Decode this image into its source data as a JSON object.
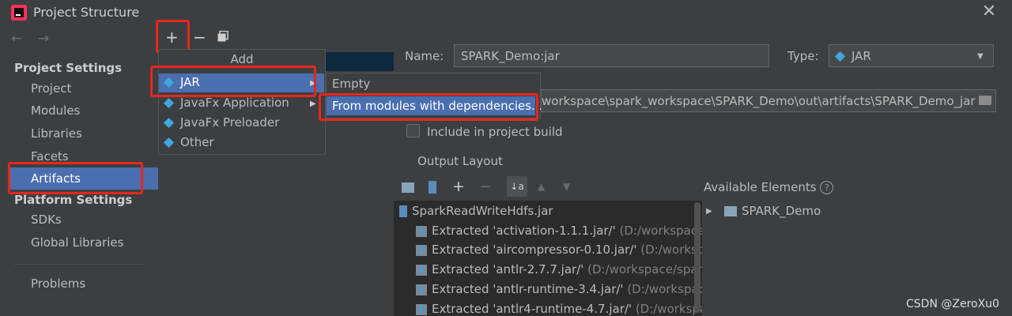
{
  "window": {
    "title": "Project Structure",
    "close_icon": "close-icon",
    "app_icon": "intellij-idea-icon"
  },
  "sidebar": {
    "back_icon": "arrow-left-icon",
    "forward_icon": "arrow-right-icon",
    "project_settings_header": "Project Settings",
    "items": [
      "Project",
      "Modules",
      "Libraries",
      "Facets",
      "Artifacts"
    ],
    "selected": "Artifacts",
    "platform_settings_header": "Platform Settings",
    "platform_items": [
      "SDKs",
      "Global Libraries"
    ],
    "problems": "Problems"
  },
  "list_toolbar": {
    "add_icon": "plus-icon",
    "remove_icon": "minus-icon",
    "copy_icon": "copy-icon"
  },
  "add_menu": {
    "title": "Add",
    "items": [
      "JAR",
      "JavaFx Application",
      "JavaFx Preloader",
      "Other"
    ],
    "selected": "JAR",
    "icon": "artifact-diamond-icon"
  },
  "jar_submenu": {
    "items": [
      "Empty",
      "From modules with dependencies..."
    ],
    "selected": "From modules with dependencies..."
  },
  "form": {
    "name_label": "Name:",
    "name_value": "SPARK_Demo:jar",
    "type_label": "Type:",
    "type_value": "JAR",
    "output_dir_value": "workspace\\spark_workspace\\SPARK_Demo\\out\\artifacts\\SPARK_Demo_jar",
    "include_in_build_label": "Include in project build",
    "include_in_build_checked": false,
    "tab_output_layout": "Output Layout"
  },
  "layout_tree": {
    "root": "SparkReadWriteHdfs.jar",
    "rows": [
      {
        "label": "Extracted 'activation-1.1.1.jar/'",
        "path": " (D:/workspace/sp"
      },
      {
        "label": "Extracted 'aircompressor-0.10.jar/'",
        "path": " (D:/workspac"
      },
      {
        "label": "Extracted 'antlr-2.7.7.jar/'",
        "path": " (D:/workspace/spark_"
      },
      {
        "label": "Extracted 'antlr-runtime-3.4.jar/'",
        "path": " (D:/workspace,"
      },
      {
        "label": "Extracted 'antlr4-runtime-4.7.jar/'",
        "path": " (D:/workspac"
      }
    ]
  },
  "available": {
    "header": "Available Elements",
    "help_icon": "question-icon",
    "items": [
      "SPARK_Demo"
    ]
  },
  "watermark": "CSDN @ZeroXu0",
  "colors": {
    "selection": "#4b6eaf",
    "highlight_box": "#e8261c",
    "background": "#3c3f41"
  }
}
